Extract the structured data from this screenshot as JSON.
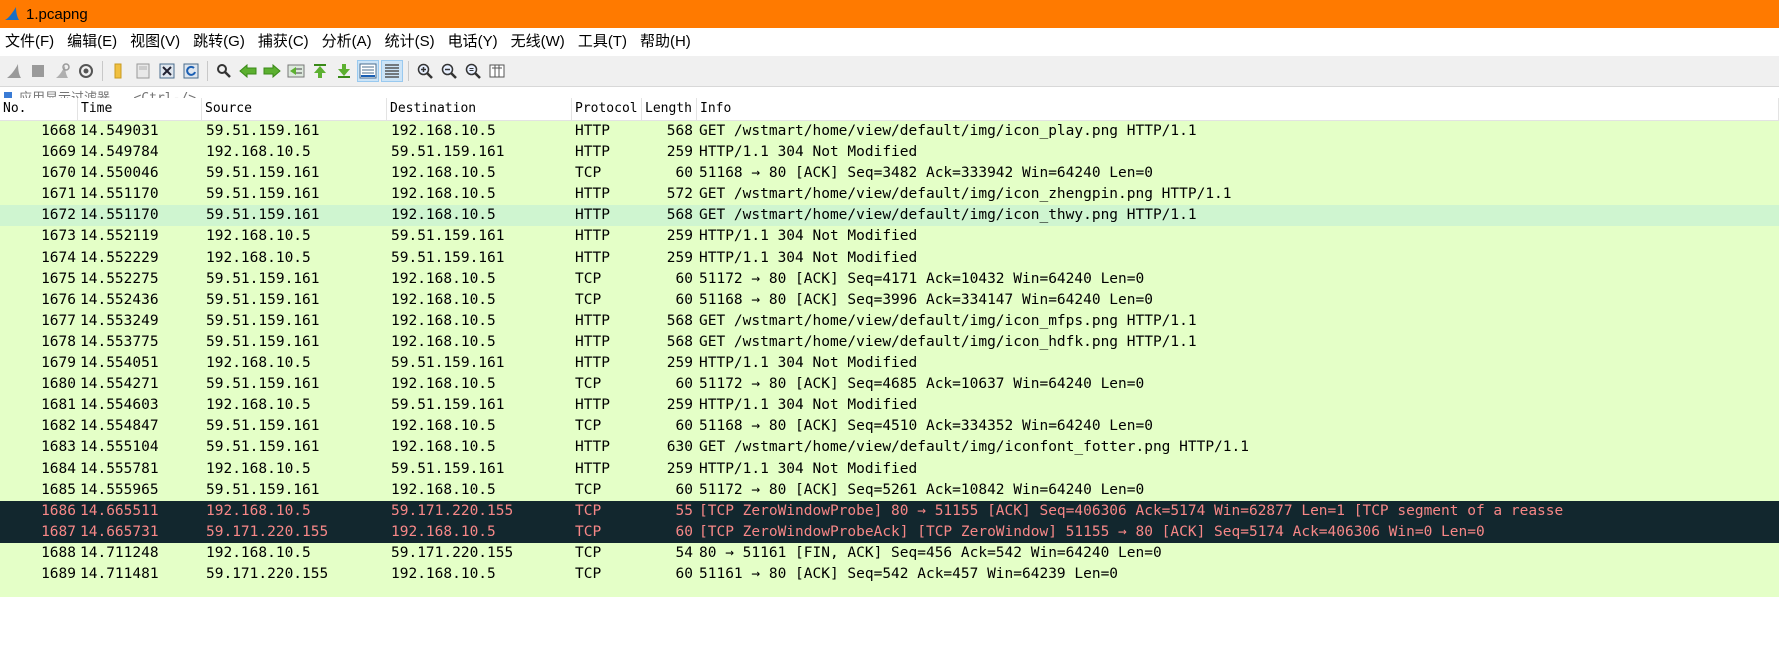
{
  "window": {
    "title": "1.pcapng"
  },
  "menu": [
    "文件(F)",
    "编辑(E)",
    "视图(V)",
    "跳转(G)",
    "捕获(C)",
    "分析(A)",
    "统计(S)",
    "电话(Y)",
    "无线(W)",
    "工具(T)",
    "帮助(H)"
  ],
  "toolbar": {
    "icons": [
      "shark-fin-start-icon",
      "stop-icon",
      "restart-icon",
      "capture-options-icon",
      "open-folder-icon",
      "save-icon",
      "close-file-icon",
      "reload-icon",
      "find-icon",
      "back-arrow-icon",
      "forward-arrow-icon",
      "go-to-packet-icon",
      "first-packet-icon",
      "last-packet-icon",
      "autoscroll-icon",
      "colorize-icon",
      "zoom-in-icon",
      "zoom-out-icon",
      "zoom-reset-icon",
      "resize-columns-icon"
    ]
  },
  "filter": {
    "placeholder": "应用显示过滤器 … <Ctrl-/>"
  },
  "columns": {
    "no": "No.",
    "time": "Time",
    "source": "Source",
    "destination": "Destination",
    "protocol": "Protocol",
    "length": "Length",
    "info": "Info"
  },
  "colors": {
    "http": "#e4ffc7",
    "tcp": "#e7e6ff",
    "bad_bg": "#12272e",
    "bad_fg": "#f78787",
    "title_bar": "#ff7a00"
  },
  "packets": [
    {
      "no": "1668",
      "time": "14.549031",
      "source": "59.51.159.161",
      "destination": "192.168.10.5",
      "protocol": "HTTP",
      "length": "568",
      "info": "GET /wstmart/home/view/default/img/icon_play.png HTTP/1.1"
    },
    {
      "no": "1669",
      "time": "14.549784",
      "source": "192.168.10.5",
      "destination": "59.51.159.161",
      "protocol": "HTTP",
      "length": "259",
      "info": "HTTP/1.1 304 Not Modified"
    },
    {
      "no": "1670",
      "time": "14.550046",
      "source": "59.51.159.161",
      "destination": "192.168.10.5",
      "protocol": "TCP",
      "length": "60",
      "info": "51168 → 80 [ACK] Seq=3482 Ack=333942 Win=64240 Len=0"
    },
    {
      "no": "1671",
      "time": "14.551170",
      "source": "59.51.159.161",
      "destination": "192.168.10.5",
      "protocol": "HTTP",
      "length": "572",
      "info": "GET /wstmart/home/view/default/img/icon_zhengpin.png HTTP/1.1"
    },
    {
      "no": "1672",
      "time": "14.551170",
      "source": "59.51.159.161",
      "destination": "192.168.10.5",
      "protocol": "HTTP",
      "length": "568",
      "info": "GET /wstmart/home/view/default/img/icon_thwy.png HTTP/1.1"
    },
    {
      "no": "1673",
      "time": "14.552119",
      "source": "192.168.10.5",
      "destination": "59.51.159.161",
      "protocol": "HTTP",
      "length": "259",
      "info": "HTTP/1.1 304 Not Modified"
    },
    {
      "no": "1674",
      "time": "14.552229",
      "source": "192.168.10.5",
      "destination": "59.51.159.161",
      "protocol": "HTTP",
      "length": "259",
      "info": "HTTP/1.1 304 Not Modified"
    },
    {
      "no": "1675",
      "time": "14.552275",
      "source": "59.51.159.161",
      "destination": "192.168.10.5",
      "protocol": "TCP",
      "length": "60",
      "info": "51172 → 80 [ACK] Seq=4171 Ack=10432 Win=64240 Len=0"
    },
    {
      "no": "1676",
      "time": "14.552436",
      "source": "59.51.159.161",
      "destination": "192.168.10.5",
      "protocol": "TCP",
      "length": "60",
      "info": "51168 → 80 [ACK] Seq=3996 Ack=334147 Win=64240 Len=0"
    },
    {
      "no": "1677",
      "time": "14.553249",
      "source": "59.51.159.161",
      "destination": "192.168.10.5",
      "protocol": "HTTP",
      "length": "568",
      "info": "GET /wstmart/home/view/default/img/icon_mfps.png HTTP/1.1"
    },
    {
      "no": "1678",
      "time": "14.553775",
      "source": "59.51.159.161",
      "destination": "192.168.10.5",
      "protocol": "HTTP",
      "length": "568",
      "info": "GET /wstmart/home/view/default/img/icon_hdfk.png HTTP/1.1"
    },
    {
      "no": "1679",
      "time": "14.554051",
      "source": "192.168.10.5",
      "destination": "59.51.159.161",
      "protocol": "HTTP",
      "length": "259",
      "info": "HTTP/1.1 304 Not Modified"
    },
    {
      "no": "1680",
      "time": "14.554271",
      "source": "59.51.159.161",
      "destination": "192.168.10.5",
      "protocol": "TCP",
      "length": "60",
      "info": "51172 → 80 [ACK] Seq=4685 Ack=10637 Win=64240 Len=0"
    },
    {
      "no": "1681",
      "time": "14.554603",
      "source": "192.168.10.5",
      "destination": "59.51.159.161",
      "protocol": "HTTP",
      "length": "259",
      "info": "HTTP/1.1 304 Not Modified"
    },
    {
      "no": "1682",
      "time": "14.554847",
      "source": "59.51.159.161",
      "destination": "192.168.10.5",
      "protocol": "TCP",
      "length": "60",
      "info": "51168 → 80 [ACK] Seq=4510 Ack=334352 Win=64240 Len=0"
    },
    {
      "no": "1683",
      "time": "14.555104",
      "source": "59.51.159.161",
      "destination": "192.168.10.5",
      "protocol": "HTTP",
      "length": "630",
      "info": "GET /wstmart/home/view/default/img/iconfont_fotter.png HTTP/1.1"
    },
    {
      "no": "1684",
      "time": "14.555781",
      "source": "192.168.10.5",
      "destination": "59.51.159.161",
      "protocol": "HTTP",
      "length": "259",
      "info": "HTTP/1.1 304 Not Modified"
    },
    {
      "no": "1685",
      "time": "14.555965",
      "source": "59.51.159.161",
      "destination": "192.168.10.5",
      "protocol": "TCP",
      "length": "60",
      "info": "51172 → 80 [ACK] Seq=5261 Ack=10842 Win=64240 Len=0"
    },
    {
      "no": "1686",
      "time": "14.665511",
      "source": "192.168.10.5",
      "destination": "59.171.220.155",
      "protocol": "TCP",
      "length": "55",
      "info": "[TCP ZeroWindowProbe] 80 → 51155 [ACK] Seq=406306 Ack=5174 Win=62877 Len=1 [TCP segment of a reasse"
    },
    {
      "no": "1687",
      "time": "14.665731",
      "source": "59.171.220.155",
      "destination": "192.168.10.5",
      "protocol": "TCP",
      "length": "60",
      "info": "[TCP ZeroWindowProbeAck] [TCP ZeroWindow] 51155 → 80 [ACK] Seq=5174 Ack=406306 Win=0 Len=0"
    },
    {
      "no": "1688",
      "time": "14.711248",
      "source": "192.168.10.5",
      "destination": "59.171.220.155",
      "protocol": "TCP",
      "length": "54",
      "info": "80 → 51161 [FIN, ACK] Seq=456 Ack=542 Win=64240 Len=0"
    },
    {
      "no": "1689",
      "time": "14.711481",
      "source": "59.171.220.155",
      "destination": "192.168.10.5",
      "protocol": "TCP",
      "length": "60",
      "info": "51161 → 80 [ACK] Seq=542 Ack=457 Win=64239 Len=0"
    }
  ]
}
